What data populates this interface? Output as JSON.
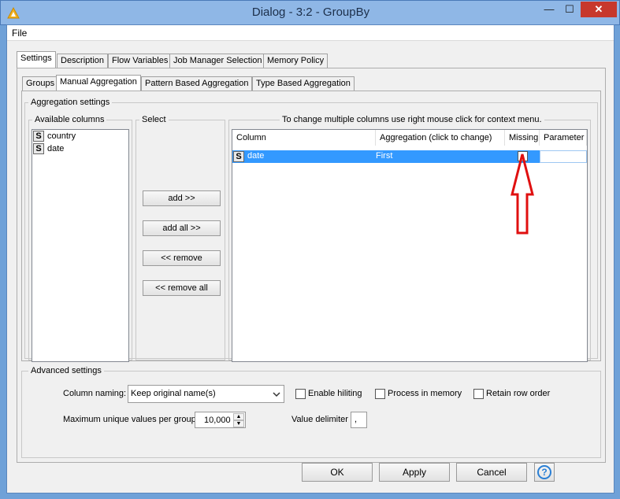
{
  "window": {
    "title": "Dialog - 3:2 - GroupBy",
    "min_glyph": "—",
    "max_glyph": "☐",
    "close_glyph": "✕"
  },
  "menu": {
    "file": "File"
  },
  "main_tabs": [
    "Settings",
    "Description",
    "Flow Variables",
    "Job Manager Selection",
    "Memory Policy"
  ],
  "sub_tabs": [
    "Groups",
    "Manual Aggregation",
    "Pattern Based Aggregation",
    "Type Based Aggregation"
  ],
  "aggregation": {
    "group_title": "Aggregation settings",
    "available_title": "Available columns",
    "available": [
      {
        "type": "S",
        "name": "country"
      },
      {
        "type": "S",
        "name": "date"
      }
    ],
    "select_title": "Select",
    "buttons": {
      "add": "add >>",
      "add_all": "add all >>",
      "remove": "<< remove",
      "remove_all": "<< remove all"
    },
    "table_title": "To change multiple columns use right mouse click for context menu.",
    "table_headers": {
      "column": "Column",
      "aggregation": "Aggregation (click to change)",
      "missing": "Missing",
      "parameter": "Parameter"
    },
    "rows": [
      {
        "type": "S",
        "column": "date",
        "aggregation": "First",
        "missing": false,
        "parameter": ""
      }
    ]
  },
  "advanced": {
    "title": "Advanced settings",
    "column_naming_label": "Column naming:",
    "column_naming_value": "Keep original name(s)",
    "enable_hiliting": "Enable hiliting",
    "process_in_memory": "Process in memory",
    "retain_row_order": "Retain row order",
    "max_unique_label": "Maximum unique values per group",
    "max_unique_value": "10,000",
    "value_delimiter_label": "Value delimiter",
    "value_delimiter_value": ","
  },
  "footer": {
    "ok": "OK",
    "apply": "Apply",
    "cancel": "Cancel",
    "help_glyph": "?"
  },
  "colors": {
    "selection": "#3399ff",
    "annotation_arrow": "#e01010",
    "close_button": "#c7382c"
  }
}
